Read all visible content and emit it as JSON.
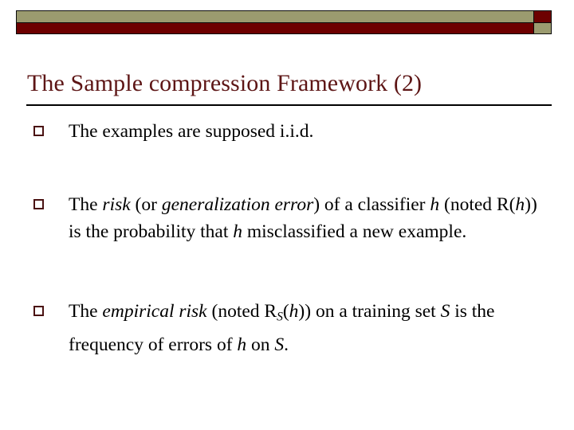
{
  "slide": {
    "title": "The Sample compression Framework (2)",
    "title_color": "#5d1515",
    "accent_olive": "#9b9b6f",
    "accent_dark_red": "#6d0000",
    "bullet_marker_color": "#4a1212",
    "body_text_color": "#000000",
    "bullets": [
      {
        "marker": "hollow-square",
        "plain_text": "The examples are supposed i.i.d.",
        "segments": [
          {
            "text": "The examples are supposed i.i.d.",
            "style": "normal"
          }
        ]
      },
      {
        "marker": "hollow-square",
        "plain_text": "The risk (or generalization error) of a classifier h (noted R(h)) is the probability that h  misclassified a new example.",
        "segments": [
          {
            "text": "The ",
            "style": "normal"
          },
          {
            "text": "risk",
            "style": "italic"
          },
          {
            "text": " (or ",
            "style": "normal"
          },
          {
            "text": "generalization error",
            "style": "italic"
          },
          {
            "text": ") of a classifier ",
            "style": "normal"
          },
          {
            "text": "h",
            "style": "italic"
          },
          {
            "text": " (noted R(",
            "style": "normal"
          },
          {
            "text": "h",
            "style": "italic"
          },
          {
            "text": ")) is the probability that ",
            "style": "normal"
          },
          {
            "text": "h",
            "style": "italic"
          },
          {
            "text": "  misclassified a new example.",
            "style": "normal"
          }
        ]
      },
      {
        "marker": "hollow-square",
        "plain_text": "The empirical risk (noted RS(h)) on a training set S is the frequency of errors of h on S.",
        "segments": [
          {
            "text": "The ",
            "style": "normal"
          },
          {
            "text": "empirical risk",
            "style": "italic"
          },
          {
            "text": " (noted R",
            "style": "normal"
          },
          {
            "text": "S",
            "style": "subscript-italic"
          },
          {
            "text": "(",
            "style": "normal"
          },
          {
            "text": "h",
            "style": "italic"
          },
          {
            "text": ")) on a training set ",
            "style": "normal"
          },
          {
            "text": "S",
            "style": "italic"
          },
          {
            "text": " is the frequency of errors of ",
            "style": "normal"
          },
          {
            "text": "h",
            "style": "italic"
          },
          {
            "text": " on ",
            "style": "normal"
          },
          {
            "text": "S",
            "style": "italic"
          },
          {
            "text": ".",
            "style": "normal"
          }
        ]
      }
    ]
  }
}
